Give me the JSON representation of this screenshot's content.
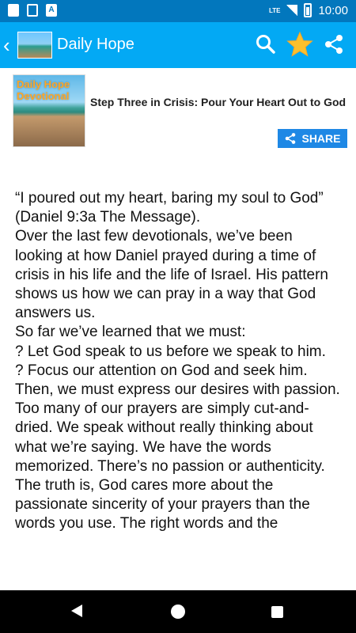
{
  "status_bar": {
    "time": "10:00",
    "network": "LTE",
    "icons": [
      "sd-card-icon",
      "image-icon",
      "font-a-icon"
    ]
  },
  "app_bar": {
    "title": "Daily Hope",
    "icons": [
      "back-icon",
      "search-icon",
      "star-icon",
      "share-icon"
    ],
    "star_color": "#fbc02d",
    "bar_color": "#03a9f4"
  },
  "article": {
    "thumbnail_text": "Daily Hope Devotional",
    "title": "Step Three in Crisis: Pour Your Heart Out to God",
    "share_label": "SHARE",
    "paragraphs": [
      "“I poured out my heart, baring my soul to God” (Daniel 9:3a The Message).",
      "Over the last few devotionals, we’ve been looking at how Daniel prayed during a time of crisis in his life and the life of Israel. His pattern shows us how we can pray in a way that God answers us.",
      "So far we’ve learned that we must:",
      "? Let God speak to us before we speak to him.",
      "? Focus our attention on God and seek him.",
      "Then, we must express our desires with passion.",
      "Too many of our prayers are simply cut-and-dried. We speak without really thinking about what we’re saying. We have the words memorized. There’s no passion or authenticity.",
      "The truth is, God cares more about the passionate sincerity of your prayers than the words you use. The right words and the"
    ]
  },
  "nav_bar": {
    "icons": [
      "nav-back-icon",
      "nav-home-icon",
      "nav-recent-icon"
    ]
  }
}
